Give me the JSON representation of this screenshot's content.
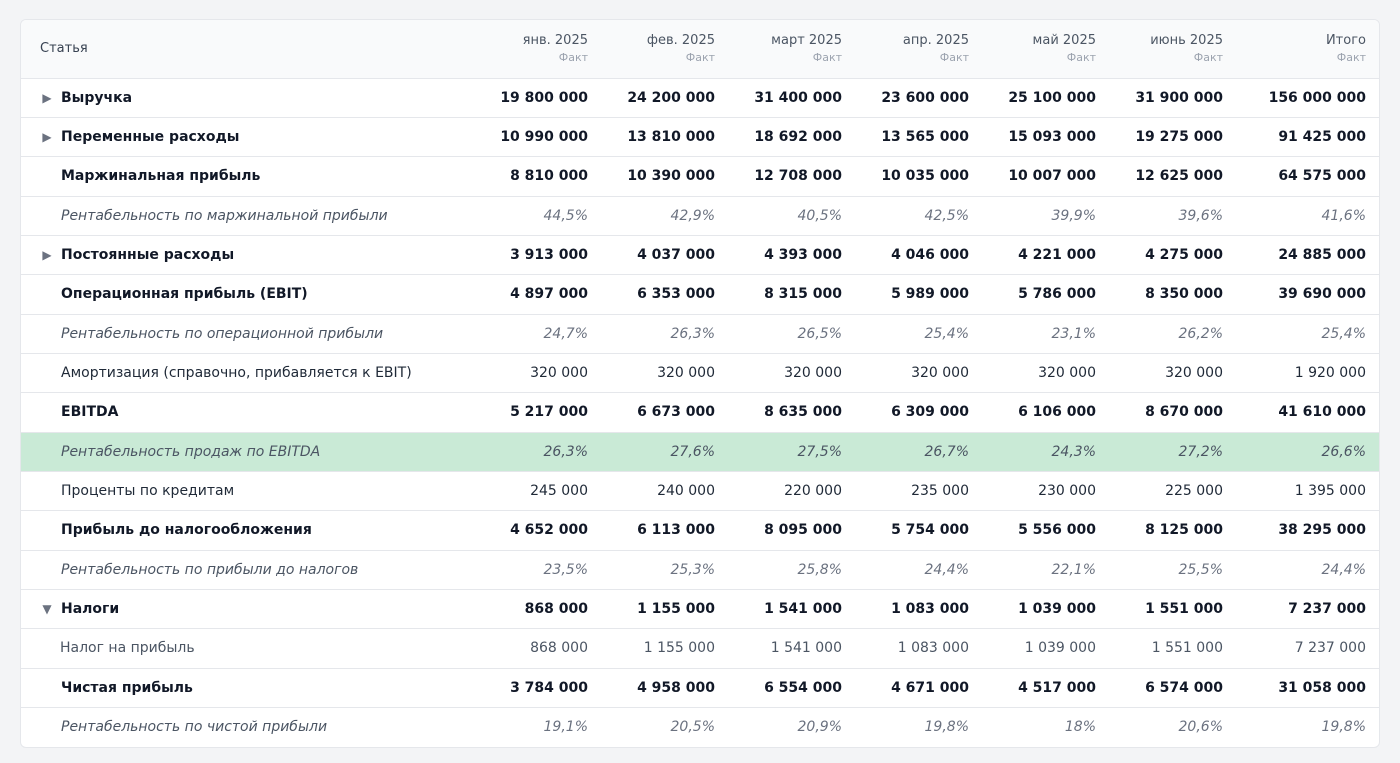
{
  "header": {
    "label": "Статья",
    "fact": "Факт",
    "months": [
      "янв. 2025",
      "фев. 2025",
      "март 2025",
      "апр. 2025",
      "май 2025",
      "июнь 2025",
      "Итого"
    ]
  },
  "rows": [
    {
      "label": "Выручка",
      "values": [
        "19 800 000",
        "24 200 000",
        "31 400 000",
        "23 600 000",
        "25 100 000",
        "31 900 000",
        "156 000 000"
      ],
      "toggle": "▶"
    },
    {
      "label": "Переменные расходы",
      "values": [
        "10 990 000",
        "13 810 000",
        "18 692 000",
        "13 565 000",
        "15 093 000",
        "19 275 000",
        "91 425 000"
      ],
      "toggle": "▶"
    },
    {
      "label": "Маржинальная прибыль",
      "values": [
        "8 810 000",
        "10 390 000",
        "12 708 000",
        "10 035 000",
        "10 007 000",
        "12 625 000",
        "64 575 000"
      ]
    },
    {
      "label": "Рентабельность по маржинальной прибыли",
      "values": [
        "44,5%",
        "42,9%",
        "40,5%",
        "42,5%",
        "39,9%",
        "39,6%",
        "41,6%"
      ]
    },
    {
      "label": "Постоянные расходы",
      "values": [
        "3 913 000",
        "4 037 000",
        "4 393 000",
        "4 046 000",
        "4 221 000",
        "4 275 000",
        "24 885 000"
      ],
      "toggle": "▶"
    },
    {
      "label": "Операционная прибыль (EBIT)",
      "values": [
        "4 897 000",
        "6 353 000",
        "8 315 000",
        "5 989 000",
        "5 786 000",
        "8 350 000",
        "39 690 000"
      ]
    },
    {
      "label": "Рентабельность по операционной прибыли",
      "values": [
        "24,7%",
        "26,3%",
        "26,5%",
        "25,4%",
        "23,1%",
        "26,2%",
        "25,4%"
      ]
    },
    {
      "label": "Амортизация (справочно, прибавляется к EBIT)",
      "values": [
        "320 000",
        "320 000",
        "320 000",
        "320 000",
        "320 000",
        "320 000",
        "1 920 000"
      ]
    },
    {
      "label": "EBITDA",
      "values": [
        "5 217 000",
        "6 673 000",
        "8 635 000",
        "6 309 000",
        "6 106 000",
        "8 670 000",
        "41 610 000"
      ]
    },
    {
      "label": "Рентабельность продаж по EBITDA",
      "values": [
        "26,3%",
        "27,6%",
        "27,5%",
        "26,7%",
        "24,3%",
        "27,2%",
        "26,6%"
      ]
    },
    {
      "label": "Проценты по кредитам",
      "values": [
        "245 000",
        "240 000",
        "220 000",
        "235 000",
        "230 000",
        "225 000",
        "1 395 000"
      ]
    },
    {
      "label": "Прибыль до налогообложения",
      "values": [
        "4 652 000",
        "6 113 000",
        "8 095 000",
        "5 754 000",
        "5 556 000",
        "8 125 000",
        "38 295 000"
      ]
    },
    {
      "label": "Рентабельность по прибыли до налогов",
      "values": [
        "23,5%",
        "25,3%",
        "25,8%",
        "24,4%",
        "22,1%",
        "25,5%",
        "24,4%"
      ]
    },
    {
      "label": "Налоги",
      "values": [
        "868 000",
        "1 155 000",
        "1 541 000",
        "1 083 000",
        "1 039 000",
        "1 551 000",
        "7 237 000"
      ],
      "toggle": "▼"
    },
    {
      "label": "Налог на прибыль",
      "values": [
        "868 000",
        "1 155 000",
        "1 541 000",
        "1 083 000",
        "1 039 000",
        "1 551 000",
        "7 237 000"
      ]
    },
    {
      "label": "Чистая прибыль",
      "values": [
        "3 784 000",
        "4 958 000",
        "6 554 000",
        "4 671 000",
        "4 517 000",
        "6 574 000",
        "31 058 000"
      ]
    },
    {
      "label": "Рентабельность по чистой прибыли",
      "values": [
        "19,1%",
        "20,5%",
        "20,9%",
        "19,8%",
        "18%",
        "20,6%",
        "19,8%"
      ]
    }
  ],
  "colors": {
    "highlight": "#c9ead6",
    "border": "#e5e7eb"
  }
}
